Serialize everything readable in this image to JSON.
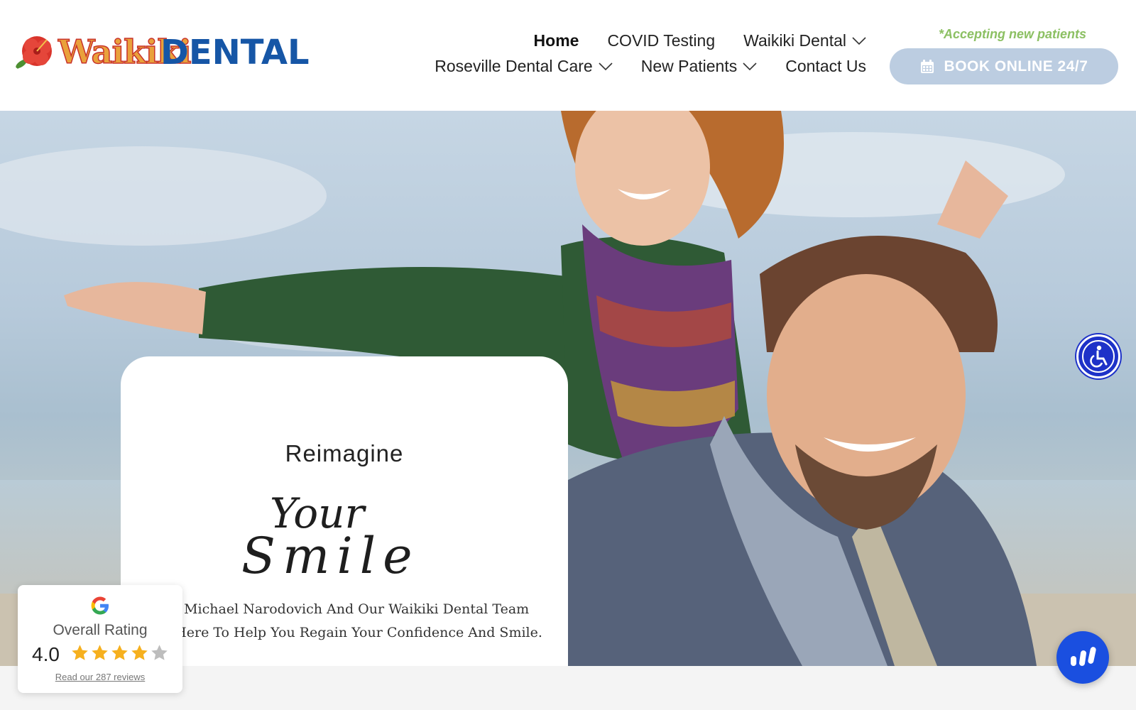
{
  "brand": {
    "logo_text_1": "Waikiki",
    "logo_text_2": "DENTAL",
    "colors": {
      "waikiki": "#e9a13b",
      "dental": "#1656a6",
      "accent_green": "#8cc063",
      "book_button": "#bccde1"
    }
  },
  "nav": {
    "row1": [
      {
        "label": "Home",
        "active": true,
        "dropdown": false
      },
      {
        "label": "COVID Testing",
        "active": false,
        "dropdown": false
      },
      {
        "label": "Waikiki Dental",
        "active": false,
        "dropdown": true
      }
    ],
    "row2": [
      {
        "label": "Roseville Dental Care",
        "active": false,
        "dropdown": true
      },
      {
        "label": "New Patients",
        "active": false,
        "dropdown": true
      },
      {
        "label": "Contact Us",
        "active": false,
        "dropdown": false
      }
    ]
  },
  "header": {
    "accepting": "*Accepting new patients",
    "book_label": "BOOK ONLINE 24/7",
    "book_icon": "calendar-icon"
  },
  "hero": {
    "reimagine": "Reimagine",
    "script_line_1": "Your",
    "script_line_2": "Smile",
    "text_line_1": "Dr. Michael Narodovich And Our Waikiki Dental Team",
    "text_line_2": "Are Here To Help You Regain Your Confidence And Smile."
  },
  "rating": {
    "icon": "google-icon",
    "label": "Overall Rating",
    "score": "4.0",
    "stars_filled": 4,
    "stars_total": 5,
    "reviews_link": "Read our 287 reviews"
  },
  "floating": {
    "accessibility_icon": "accessibility-icon",
    "chat_icon": "chat-widget-icon"
  }
}
